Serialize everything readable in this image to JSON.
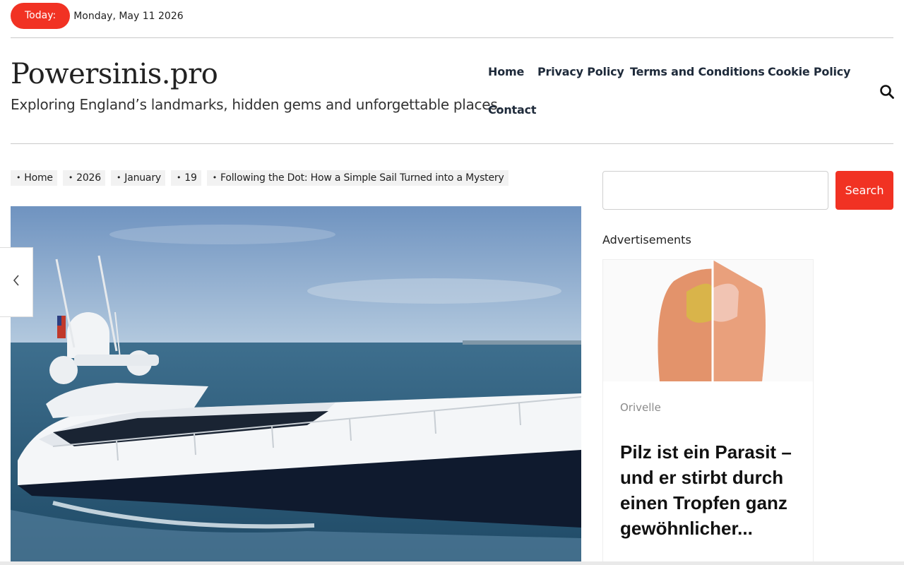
{
  "topbar": {
    "today_label": "Today:",
    "date": "Monday, May 11 2026"
  },
  "header": {
    "site_title": "Powersinis.pro",
    "tagline": "Exploring England’s landmarks, hidden gems and unforgettable places."
  },
  "nav": {
    "items": [
      {
        "label": "Home"
      },
      {
        "label": "Privacy Policy"
      },
      {
        "label": "Terms and Conditions"
      },
      {
        "label": "Cookie Policy"
      },
      {
        "label": "Contact"
      }
    ]
  },
  "breadcrumb": [
    "Home",
    "2026",
    "January",
    "19",
    "Following the Dot: How a Simple Sail Turned into a Mystery"
  ],
  "sidebar": {
    "search_placeholder": "",
    "search_button": "Search",
    "ads_label": "Advertisements",
    "ad": {
      "brand": "Orivelle",
      "headline": "Pilz ist ein Parasit – und er stirbt durch einen Tropfen ganz gewöhnlicher..."
    }
  },
  "colors": {
    "accent": "#f13223",
    "nav_text": "#1e2a3a"
  },
  "icons": {
    "search": "search-icon",
    "prev": "chevron-left-icon",
    "adchoices": "adchoices-icon"
  }
}
